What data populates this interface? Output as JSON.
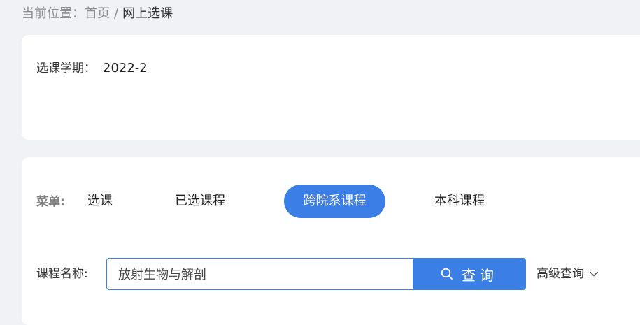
{
  "breadcrumb": {
    "prefix": "当前位置：",
    "home": "首页",
    "separator": "/",
    "current": "网上选课"
  },
  "semester": {
    "label": "选课学期：",
    "value": "2022-2"
  },
  "menu": {
    "label": "菜单:",
    "items": [
      {
        "label": "选课",
        "active": false
      },
      {
        "label": "已选课程",
        "active": false
      },
      {
        "label": "跨院系课程",
        "active": true
      },
      {
        "label": "本科课程",
        "active": false
      }
    ]
  },
  "search": {
    "label": "课程名称:",
    "value": "放射生物与解剖",
    "button_label": "查询",
    "advanced_label": "高级查询"
  },
  "colors": {
    "primary": "#3a7ee6",
    "background": "#f0f2f5",
    "card": "#ffffff"
  },
  "icons": {
    "search": "search-icon",
    "advanced": "chevron-down-icon"
  }
}
